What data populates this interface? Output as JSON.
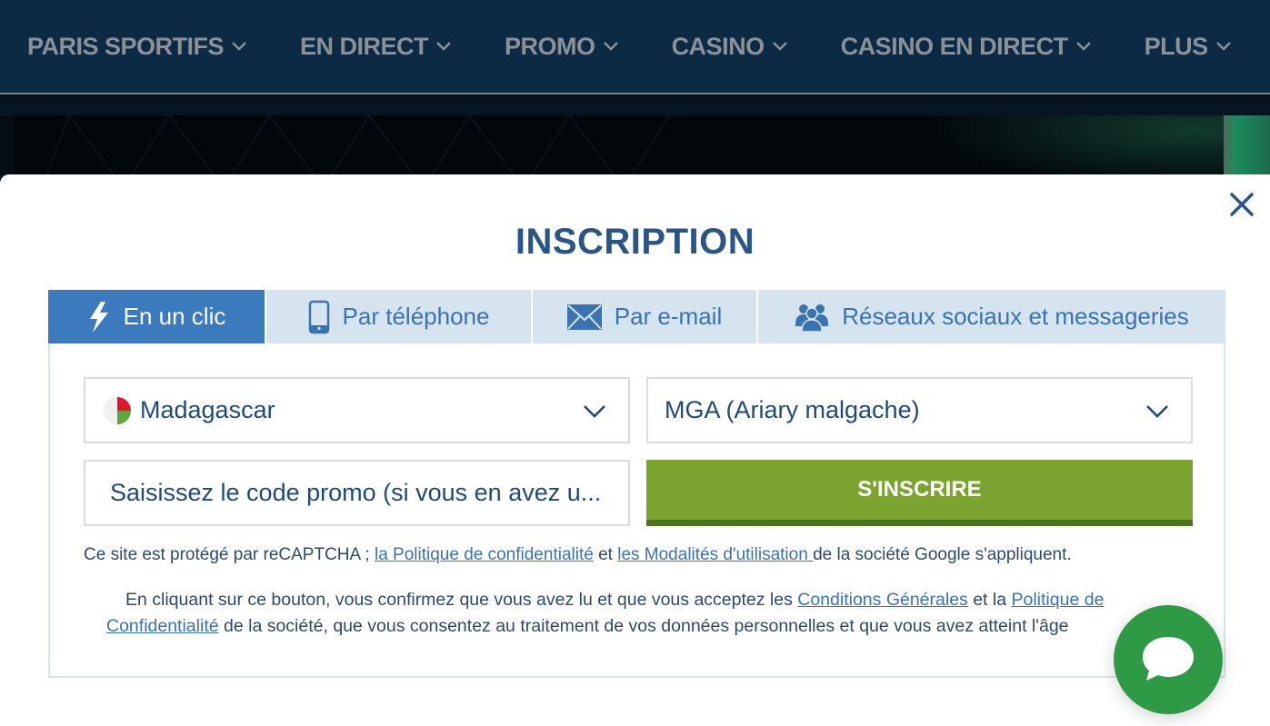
{
  "nav": {
    "items": [
      {
        "label": "PARIS SPORTIFS"
      },
      {
        "label": "EN DIRECT"
      },
      {
        "label": "PROMO"
      },
      {
        "label": "CASINO"
      },
      {
        "label": "CASINO EN DIRECT"
      },
      {
        "label": "PLUS"
      }
    ]
  },
  "modal": {
    "title": "INSCRIPTION",
    "close_icon": "close-icon",
    "tabs": [
      {
        "label": "En un clic",
        "icon": "lightning-icon",
        "active": true
      },
      {
        "label": "Par téléphone",
        "icon": "phone-icon",
        "active": false
      },
      {
        "label": "Par e-mail",
        "icon": "envelope-icon",
        "active": false
      },
      {
        "label": "Réseaux sociaux et messageries",
        "icon": "users-icon",
        "active": false
      }
    ],
    "form": {
      "country": {
        "value": "Madagascar",
        "flag": "madagascar-flag"
      },
      "currency": {
        "value": "MGA (Ariary malgache)"
      },
      "promo": {
        "value": "",
        "placeholder": "Saisissez le code promo (si vous en avez u..."
      },
      "submit_label": "S'INSCRIRE"
    },
    "legal": {
      "recaptcha_prefix": "Ce site est protégé par reCAPTCHA ; ",
      "privacy_link": "la Politique de confidentialité",
      "and": " et ",
      "terms_link": "les Modalités d'utilisation ",
      "recaptcha_suffix": "de la société Google s'appliquent.",
      "consent_prefix": "En cliquant sur ce bouton, vous confirmez que vous avez lu et que vous acceptez les ",
      "conditions_link": "Conditions Générales",
      "consent_and": " et la ",
      "policy_link": "Politique de Confidentialité",
      "consent_suffix": " de la société, que vous consentez au traitement de vos données personnelles et que vous avez atteint l'âge"
    }
  },
  "colors": {
    "nav_bg": "#0d2a45",
    "title": "#2a5585",
    "active_tab": "#3b7bbd",
    "tab_bg": "#d6e4f0",
    "submit": "#7aa330",
    "chat": "#2e9a46"
  },
  "chat": {
    "icon": "chat-bubble-icon"
  }
}
